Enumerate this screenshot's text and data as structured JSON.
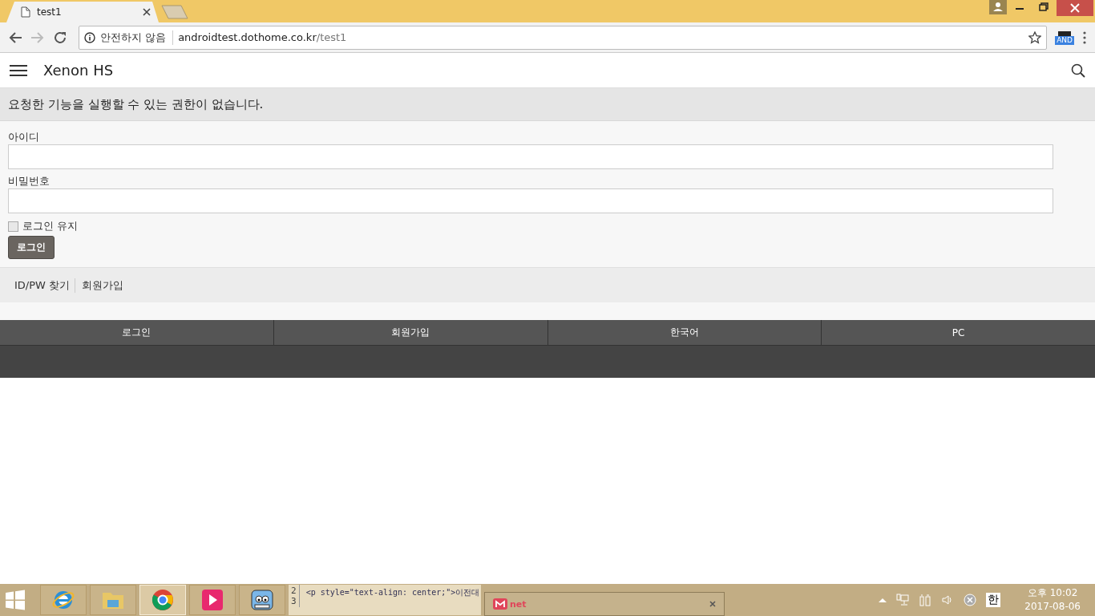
{
  "browser": {
    "tab_title": "test1",
    "security": "안전하지 않음",
    "url_host": "androidtest.dothome.co.kr",
    "url_path": "/test1",
    "extension_badge": "AND"
  },
  "header": {
    "title": "Xenon HS"
  },
  "alert": "요청한 기능을 실행할 수 있는 권한이 없습니다.",
  "form": {
    "fields": [
      {
        "label": "아이디"
      },
      {
        "label": "비밀번호"
      }
    ],
    "remember": {
      "label": "로그인 유지",
      "checked": false
    },
    "submit": "로그인"
  },
  "links": [
    "ID/PW 찾기",
    "회원가입"
  ],
  "footer_menu": [
    "로그인",
    "회원가입",
    "한국어",
    "PC"
  ],
  "taskbar": {
    "apps": [
      {
        "kind": "ie",
        "selected": false
      },
      {
        "kind": "folder",
        "selected": false
      },
      {
        "kind": "chrome",
        "selected": true
      },
      {
        "kind": "player",
        "selected": false
      },
      {
        "kind": "robot",
        "selected": false
      }
    ],
    "line_numbers": [
      "2",
      "3"
    ],
    "code": "<p style=\"text-align: center;\">이전대",
    "popup_label": "net",
    "ime": "한",
    "time": "오후 10:02",
    "date": "2017-08-06"
  }
}
